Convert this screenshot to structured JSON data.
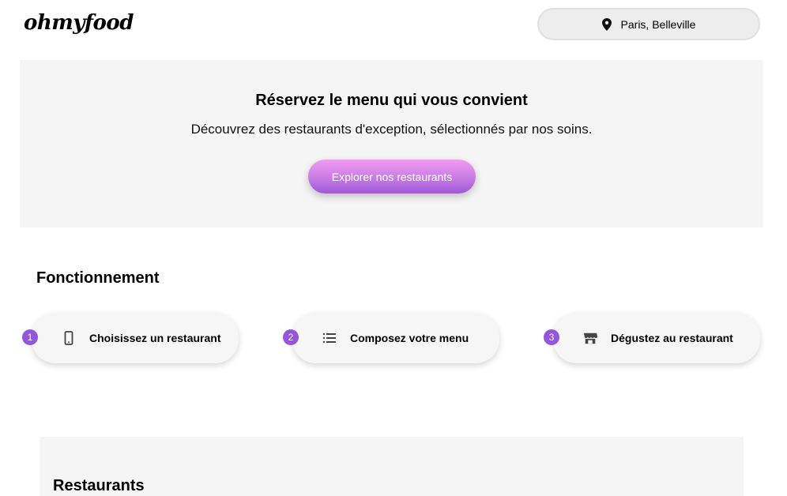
{
  "header": {
    "logo": "ohmyfood",
    "location": "Paris, Belleville"
  },
  "hero": {
    "title": "Réservez le menu qui vous convient",
    "subtitle": "Découvrez des restaurants d'exception, sélectionnés par nos soins.",
    "cta_label": "Explorer nos restaurants"
  },
  "how_it_works": {
    "title": "Fonctionnement",
    "steps": [
      {
        "number": "1",
        "label": "Choisissez un restaurant",
        "icon": "mobile-phone-icon"
      },
      {
        "number": "2",
        "label": "Composez votre menu",
        "icon": "list-icon"
      },
      {
        "number": "3",
        "label": "Dégustez au restaurant",
        "icon": "store-icon"
      }
    ]
  },
  "restaurants": {
    "title": "Restaurants"
  },
  "colors": {
    "accent": "#9356dc",
    "cta_top": "#f19bf0",
    "cta_bottom": "#9f58d8",
    "panel": "#f5f5f5"
  }
}
